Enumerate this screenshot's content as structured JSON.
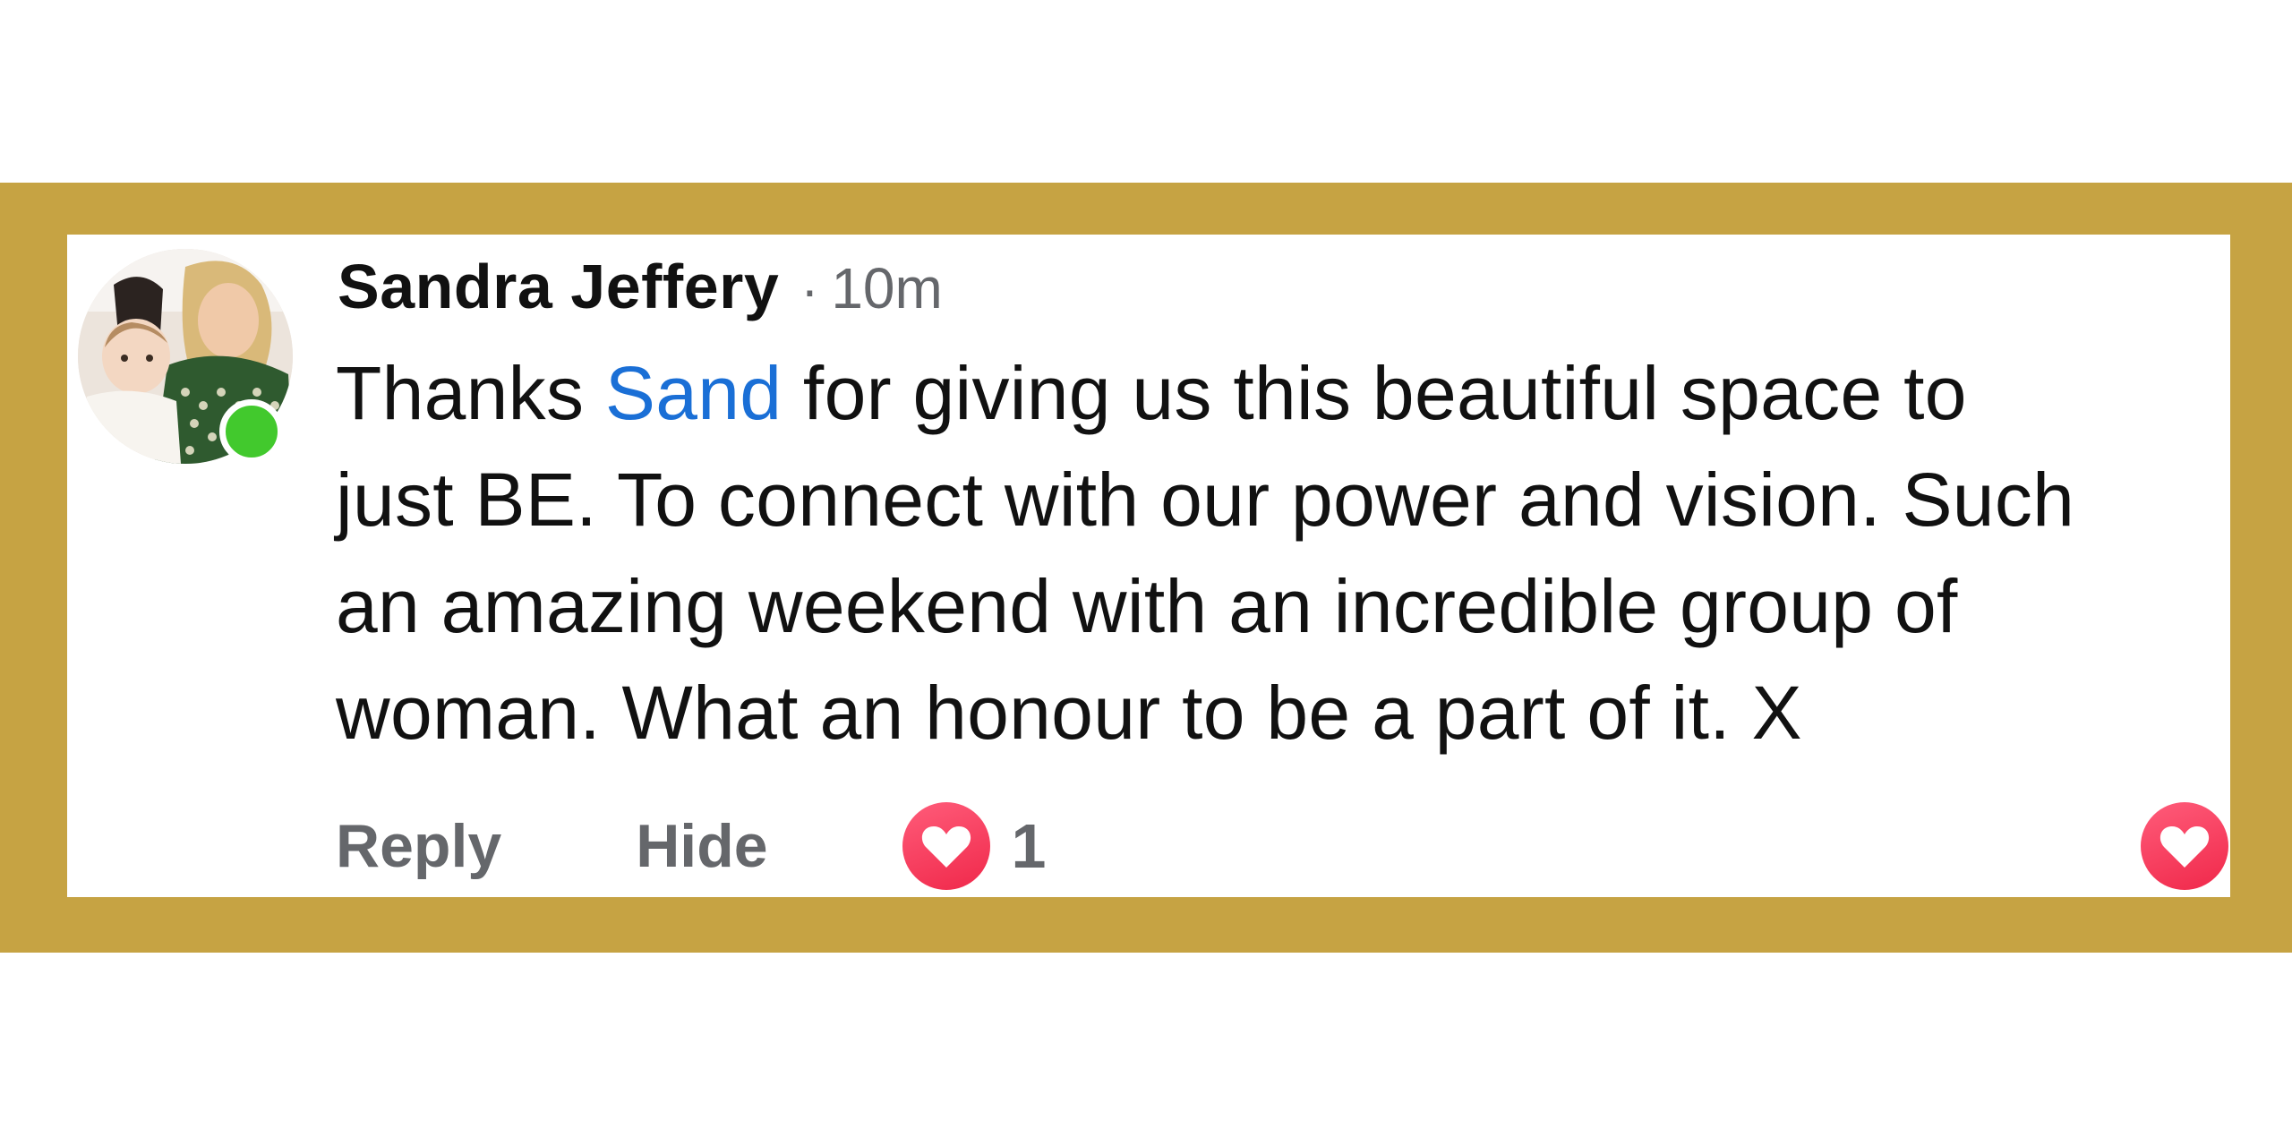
{
  "comment": {
    "author": "Sandra Jeffery",
    "separator": "·",
    "time": "10m",
    "text_lines": [
      {
        "before": "Thanks ",
        "mention": "Sand",
        "after": " for giving us this beautiful space to"
      },
      {
        "text": "just BE. To connect with our power and vision. Such"
      },
      {
        "text": "an amazing weekend with an incredible group of"
      },
      {
        "text": "woman. What an honour to be a part of it. X"
      }
    ],
    "online": true
  },
  "actions": {
    "reply_label": "Reply",
    "hide_label": "Hide",
    "reaction_count": "1",
    "reaction_icon": "heart-icon"
  },
  "colors": {
    "frame": "#c6a343",
    "mention": "#1a6fd6",
    "online": "#42c92d",
    "heart": "#f0284a",
    "secondary_text": "#65676b"
  }
}
